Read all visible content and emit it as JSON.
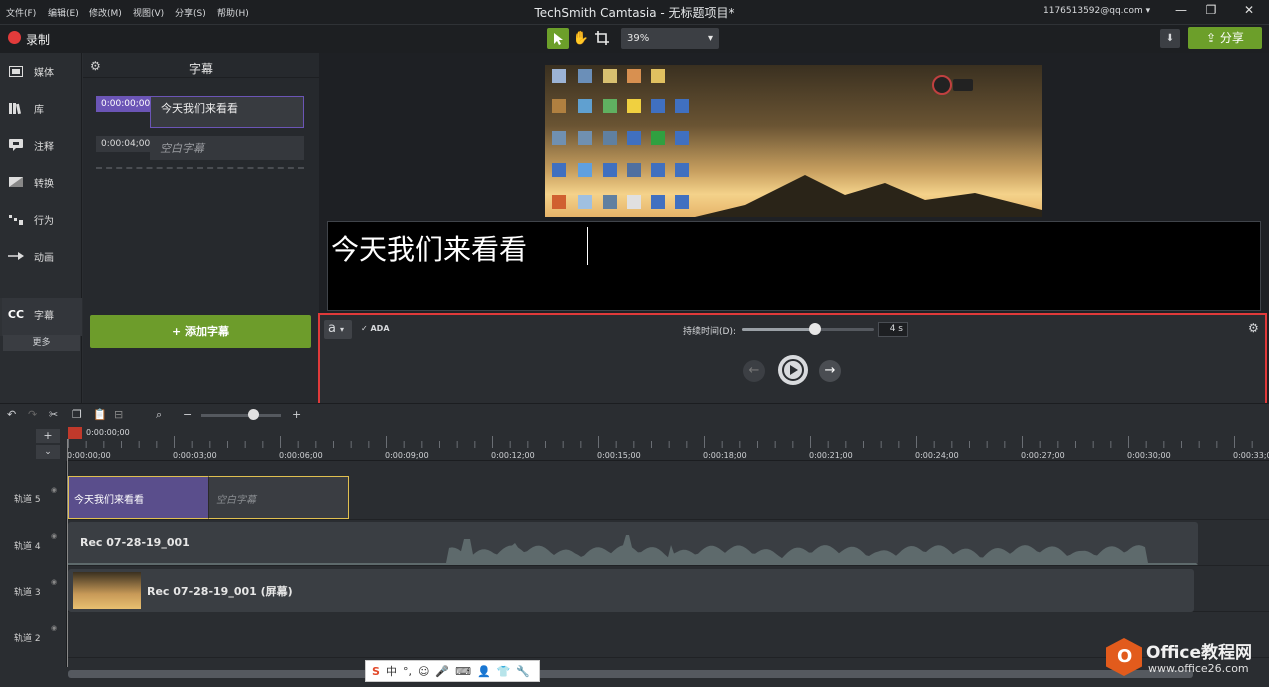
{
  "menu": [
    "文件(F)",
    "编辑(E)",
    "修改(M)",
    "视图(V)",
    "分享(S)",
    "帮助(H)"
  ],
  "title": "TechSmith Camtasia - 无标题项目*",
  "account": "1176513592@qq.com ▾",
  "window_controls": [
    "—",
    "❐",
    "✕"
  ],
  "toolbar": {
    "record": "录制",
    "zoom": "39%",
    "share": "分享"
  },
  "sidebar": {
    "items": [
      {
        "label": "媒体",
        "icon": "film-icon"
      },
      {
        "label": "库",
        "icon": "library-icon"
      },
      {
        "label": "注释",
        "icon": "annotation-icon"
      },
      {
        "label": "转换",
        "icon": "transition-icon"
      },
      {
        "label": "行为",
        "icon": "behavior-icon"
      },
      {
        "label": "动画",
        "icon": "animation-icon"
      }
    ],
    "captions_label": "字幕",
    "captions_icon": "CC",
    "more": "更多"
  },
  "captions_panel": {
    "title": "字幕",
    "items": [
      {
        "time": "0:00:00;00",
        "text": "今天我们来看看"
      },
      {
        "time": "0:00:04;00",
        "text": "空白字幕"
      }
    ],
    "add_button": "+ 添加字幕"
  },
  "caption_editor": {
    "text": "今天我们来看看",
    "font_button": "a",
    "ada": "✓ ADA",
    "duration_label": "持续时间(D):",
    "duration_value": "4 s",
    "duration_fraction": 0.55
  },
  "timeline": {
    "playhead_time": "0:00:00;00",
    "ticks": [
      "0:00:00;00",
      "0:00:03;00",
      "0:00:06;00",
      "0:00:09;00",
      "0:00:12;00",
      "0:00:15;00",
      "0:00:18;00",
      "0:00:21;00",
      "0:00:24;00",
      "0:00:27;00",
      "0:00:30;00",
      "0:00:33;0"
    ],
    "tracks": [
      "轨道 5",
      "轨道 4",
      "轨道 3",
      "轨道 2"
    ],
    "clips": {
      "caption1": "今天我们来看看",
      "caption2": "空白字幕",
      "audio": "Rec 07-28-19_001",
      "screen": "Rec 07-28-19_001 (屏幕)"
    }
  },
  "watermark": {
    "brand": "Office教程网",
    "url": "www.office26.com"
  }
}
